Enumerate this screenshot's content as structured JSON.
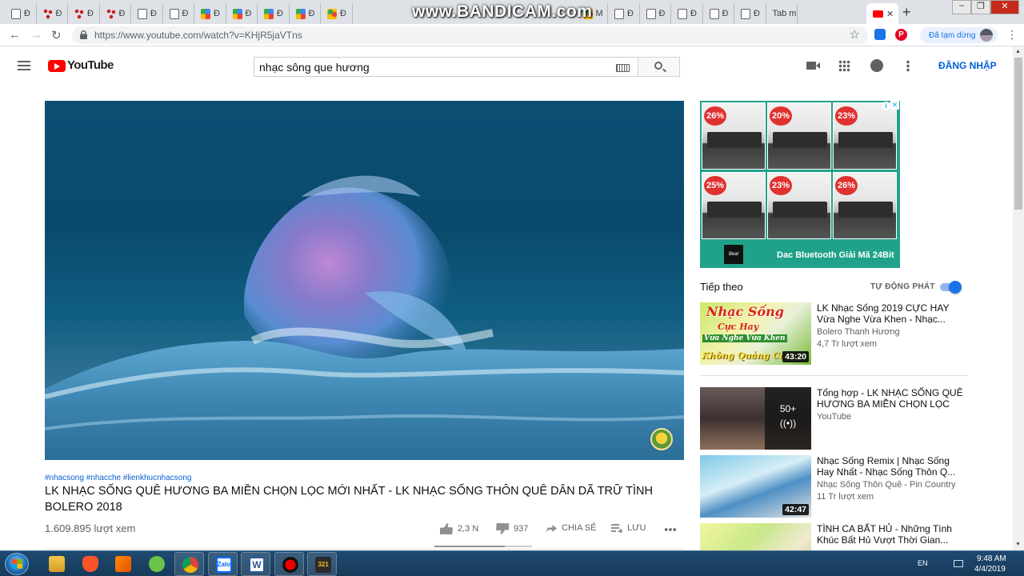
{
  "browser": {
    "tabs": [
      {
        "icon": "document-icon",
        "label": "Đ"
      },
      {
        "icon": "dots-icon",
        "label": "Đ"
      },
      {
        "icon": "dots-icon",
        "label": "Đ"
      },
      {
        "icon": "dots-icon",
        "label": "Đ"
      },
      {
        "icon": "document-icon",
        "label": "Đ"
      },
      {
        "icon": "document-icon",
        "label": "Đ"
      },
      {
        "icon": "grid-icon",
        "label": "Đ"
      },
      {
        "icon": "grid-icon",
        "label": "Đ"
      },
      {
        "icon": "grid-icon",
        "label": "Đ"
      },
      {
        "icon": "grid-icon",
        "label": "Đ"
      },
      {
        "icon": "ball-icon",
        "label": "Đ"
      },
      {
        "icon": "ball-icon",
        "label": "M"
      },
      {
        "icon": "document-icon",
        "label": "Đ"
      },
      {
        "icon": "document-icon",
        "label": "Đ"
      },
      {
        "icon": "document-icon",
        "label": "Đ"
      },
      {
        "icon": "document-icon",
        "label": "Đ"
      },
      {
        "icon": "document-icon",
        "label": "Đ"
      },
      {
        "icon": "none",
        "label": "Tab m"
      }
    ],
    "active_tab_icon": "youtube-tab-icon",
    "recording_watermark": "www.BANDICAM.com",
    "url": "https://www.youtube.com/watch?v=KHjR5jaVTns",
    "paused_label": "Đã tạm dừng",
    "pinterest_glyph": "P"
  },
  "youtube": {
    "logo_text": "YouTube",
    "search_value": "nhạc sông que hương",
    "signin_label": "ĐĂNG NHẬP"
  },
  "video": {
    "hashtags": "#nhacsong #nhacche #lienkhucnhacsong",
    "title": "LK NHẠC SỐNG QUÊ HƯƠNG BA MIỀN CHỌN LỌC MỚI NHẤT - LK NHẠC SỐNG THÔN QUÊ DÂN DÃ TRỮ TÌNH BOLERO 2018",
    "views": "1.609.895 lượt xem",
    "likes": "2,3 N",
    "dislikes": "937",
    "share_label": "CHIA SẺ",
    "save_label": "LƯU",
    "like_ratio": 0.72
  },
  "ad": {
    "discounts": [
      "26%",
      "20%",
      "23%",
      "25%",
      "23%",
      "26%"
    ],
    "brand": "Beat",
    "headline": "Dac Bluetooth Giải Mã 24Bit",
    "info_glyph": "i",
    "close_glyph": "✕"
  },
  "upnext": {
    "label": "Tiếp theo",
    "autoplay_label": "TỰ ĐỘNG PHÁT",
    "autoplay_on": true,
    "items": [
      {
        "title": "LK Nhạc Sống 2019 CỰC HAY Vừa Nghe Vừa Khen - Nhạc...",
        "channel": "Bolero Thanh Hương",
        "views": "4,7 Tr lượt xem",
        "duration": "43:20",
        "thumb_text": [
          "Nhạc Sống",
          "Cực Hay",
          "Vừa Nghe Vừa Khen",
          "Không Quảng Cáo"
        ]
      },
      {
        "title": "Tổng hợp - LK NHẠC SỐNG QUÊ HƯƠNG BA MIỀN CHỌN LỌC MỚI...",
        "channel": "YouTube",
        "views": "",
        "playlist_count": "50+",
        "playlist_glyph": "((•))"
      },
      {
        "title": "Nhạc Sống Remix | Nhạc Sống Hay Nhất - Nhạc Sống Thôn Q...",
        "channel": "Nhạc Sống Thôn Quê - Pin Country",
        "views": "11 Tr lượt xem",
        "duration": "42:47"
      },
      {
        "title": "TÌNH CA BẤT HỦ - Những Tình Khúc Bất Hủ Vượt Thời Gian...",
        "channel": "",
        "views": ""
      }
    ]
  },
  "taskbar": {
    "apps": [
      "explorer",
      "brave",
      "media-player",
      "coccoc",
      "chrome",
      "zalo",
      "word",
      "bandicam",
      "tv-app"
    ],
    "open_apps": [
      "chrome",
      "zalo",
      "word",
      "bandicam",
      "tv-app"
    ],
    "zalo_label": "Zalo",
    "word_label": "W",
    "tv_label": "321",
    "language": "EN",
    "time": "9:48 AM",
    "date": "4/4/2019"
  }
}
